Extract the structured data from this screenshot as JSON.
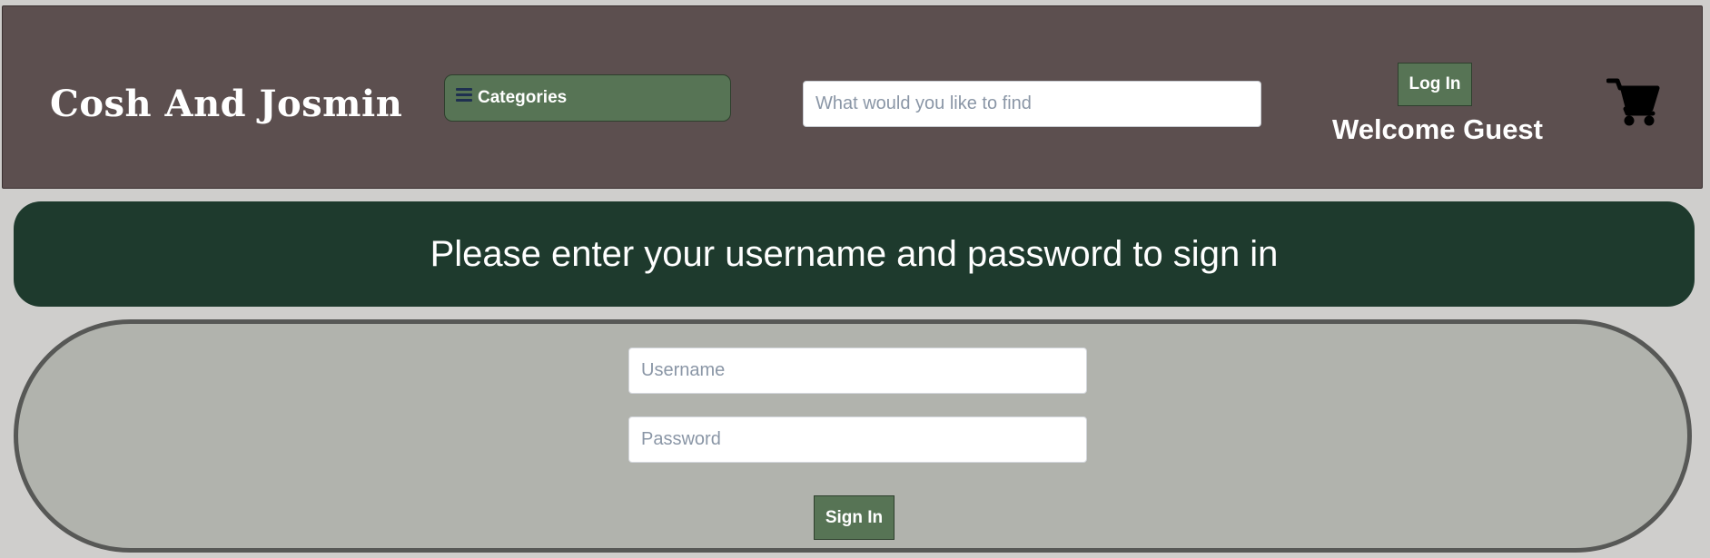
{
  "header": {
    "brand": "Cosh And Josmin",
    "categories_label": "Categories",
    "search_placeholder": "What would you like to find",
    "login_label": "Log In",
    "welcome_text": "Welcome Guest",
    "icons": {
      "menu": "hamburger-icon",
      "cart": "shopping-cart-icon"
    }
  },
  "banner": {
    "text": "Please enter your username and password to sign in"
  },
  "login_form": {
    "username_placeholder": "Username",
    "password_placeholder": "Password",
    "submit_label": "Sign In"
  },
  "colors": {
    "page_background": "#cfcecc",
    "header_background": "#5c4f4f",
    "button_green": "#577455",
    "banner_background": "#1e3a2d",
    "form_background": "#b1b3ad",
    "form_border": "#575856"
  }
}
